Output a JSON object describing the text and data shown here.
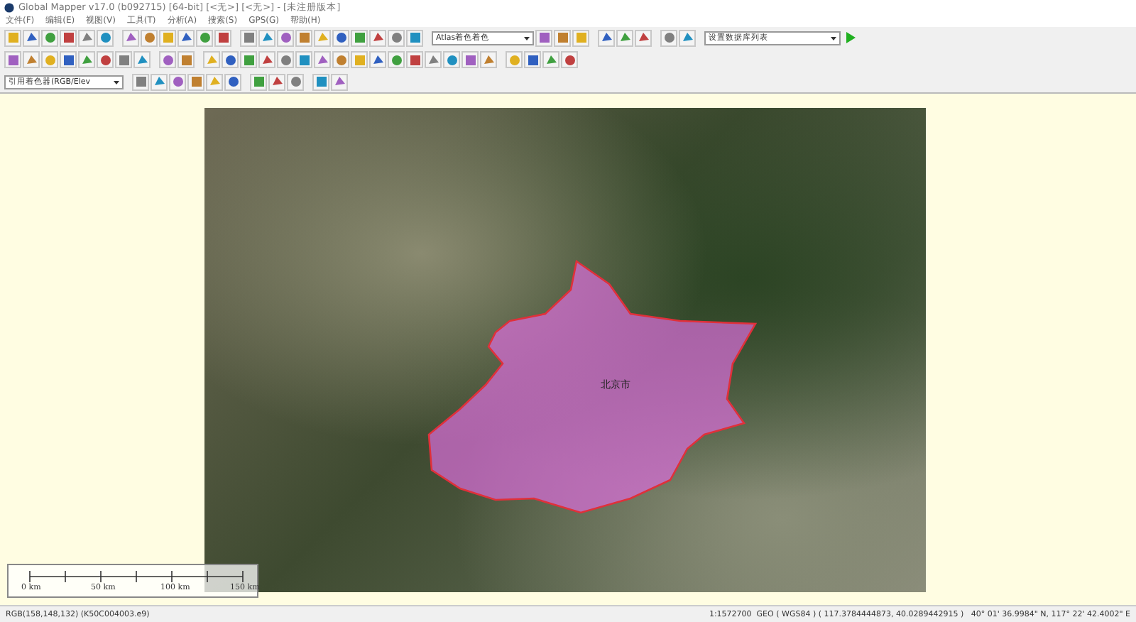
{
  "window": {
    "title": "Global Mapper v17.0 (b092715) [64-bit] [<无>] [<无>] - [未注册版本]"
  },
  "menu": [
    "文件(F)",
    "编辑(E)",
    "视图(V)",
    "工具(T)",
    "分析(A)",
    "搜索(S)",
    "GPS(G)",
    "帮助(H)"
  ],
  "toolbars": {
    "shader_dropdown": "Atlas着色着色",
    "workspace_dropdown": "设置数据库列表",
    "style_dropdown": "引用着色器(RGB/Elev"
  },
  "map": {
    "region_label": "北京市",
    "scale_labels": [
      "0 km",
      "50 km",
      "100 km",
      "150 km"
    ]
  },
  "status_bar": {
    "pixel_info": "RGB(158,148,132) (K50C004003.e9)",
    "position": "1:1572700  GEO ( WGS84 ) ( 117.3784444873, 40.0289442915 )   40° 01' 36.9984\" N, 117° 22' 42.4002\" E"
  }
}
